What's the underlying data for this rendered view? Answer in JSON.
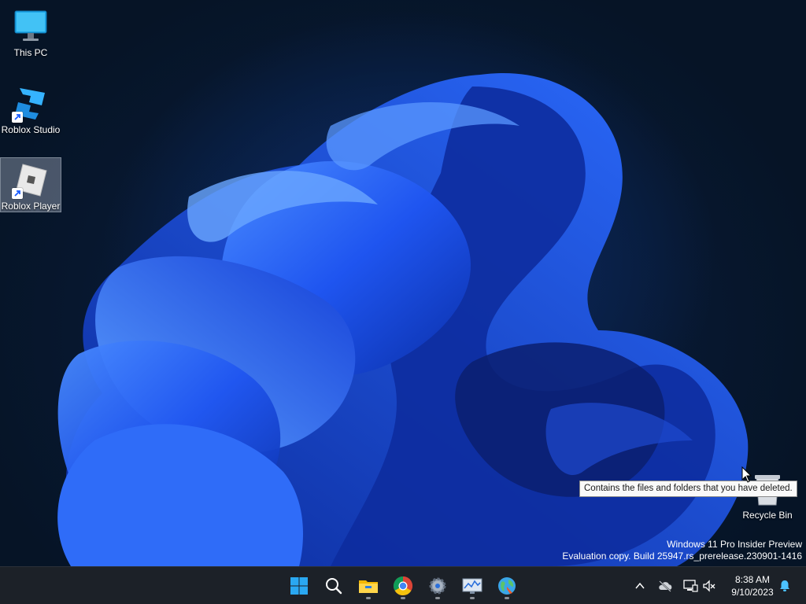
{
  "desktop": {
    "icons": [
      {
        "label": "This PC",
        "icon": "monitor-icon"
      },
      {
        "label": "Roblox Studio",
        "icon": "roblox-studio-icon"
      },
      {
        "label": "Roblox Player",
        "icon": "roblox-player-icon"
      },
      {
        "label": "Recycle Bin",
        "icon": "recycle-bin-icon"
      }
    ],
    "tooltip": "Contains the files and folders that you have deleted.",
    "watermark": {
      "line1": "Windows 11 Pro Insider Preview",
      "line2": "Evaluation copy. Build 25947.rs_prerelease.230901-1416"
    }
  },
  "taskbar": {
    "apps": [
      {
        "name": "Start",
        "icon": "windows-logo-icon"
      },
      {
        "name": "Search",
        "icon": "search-icon"
      },
      {
        "name": "File Explorer",
        "icon": "folder-icon"
      },
      {
        "name": "Google Chrome",
        "icon": "chrome-icon"
      },
      {
        "name": "Settings",
        "icon": "gear-icon"
      },
      {
        "name": "Resource Monitor",
        "icon": "monitor-chart-icon"
      },
      {
        "name": "Browser",
        "icon": "globe-icon"
      }
    ],
    "tray": [
      "chevron-up-icon",
      "cloud-offline-icon",
      "network-icon",
      "volume-muted-icon",
      "bell-icon"
    ],
    "clock": {
      "time": "8:38 AM",
      "date": "9/10/2023"
    }
  },
  "colors": {
    "accent": "#1a5cff",
    "taskbar": "#1c2128",
    "start_blue": "#2aa8f2"
  }
}
